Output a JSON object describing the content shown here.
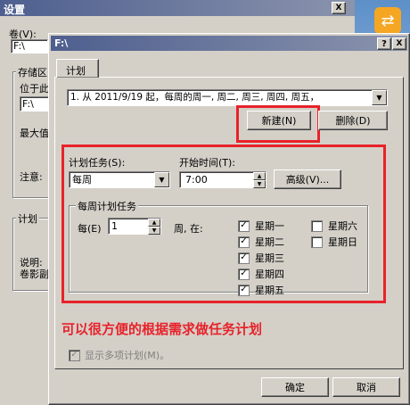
{
  "back_window": {
    "title": "设置",
    "close_label": "X",
    "volume_label": "卷(V):",
    "volume_value": "F:\\",
    "storage_label": "存储区",
    "location_label": "位于此",
    "location_value": "F:\\",
    "max_label": "最大值",
    "note_label": "注意:",
    "schedule_label": "计划",
    "description_label": "说明:",
    "description_text": "卷影副"
  },
  "dialog": {
    "title": "F:\\",
    "help_label": "?",
    "close_label": "X",
    "tab_label": "计划",
    "schedule_value": "1. 从 2011/9/19 起，每周的周一, 周二, 周三, 周四, 周五，",
    "new_button": "新建(N)",
    "delete_button": "删除(D)",
    "task_label": "计划任务(S):",
    "task_value": "每周",
    "start_label": "开始时间(T):",
    "start_value": "7:00",
    "advanced_button": "高级(V)...",
    "weekly_group_label": "每周计划任务",
    "every_label": "每(E)",
    "every_value": "1",
    "week_on_label": "周, 在:",
    "days": [
      {
        "label": "星期一",
        "checked": true
      },
      {
        "label": "星期二",
        "checked": true
      },
      {
        "label": "星期三",
        "checked": true
      },
      {
        "label": "星期四",
        "checked": true
      },
      {
        "label": "星期五",
        "checked": true
      },
      {
        "label": "星期六",
        "checked": false
      },
      {
        "label": "星期日",
        "checked": false
      }
    ],
    "annotation": "可以很方便的根据需求做任务计划",
    "show_multiple_label": "显示多项计划(M)。",
    "ok_button": "确定",
    "cancel_button": "取消"
  },
  "colors": {
    "annotation": "#e8222a",
    "face": "#d4d0c8",
    "title_start": "#4e5f8f"
  },
  "icons": {
    "check": "✓",
    "dropdown": "▼",
    "spin_up": "▲",
    "spin_down": "▼"
  }
}
